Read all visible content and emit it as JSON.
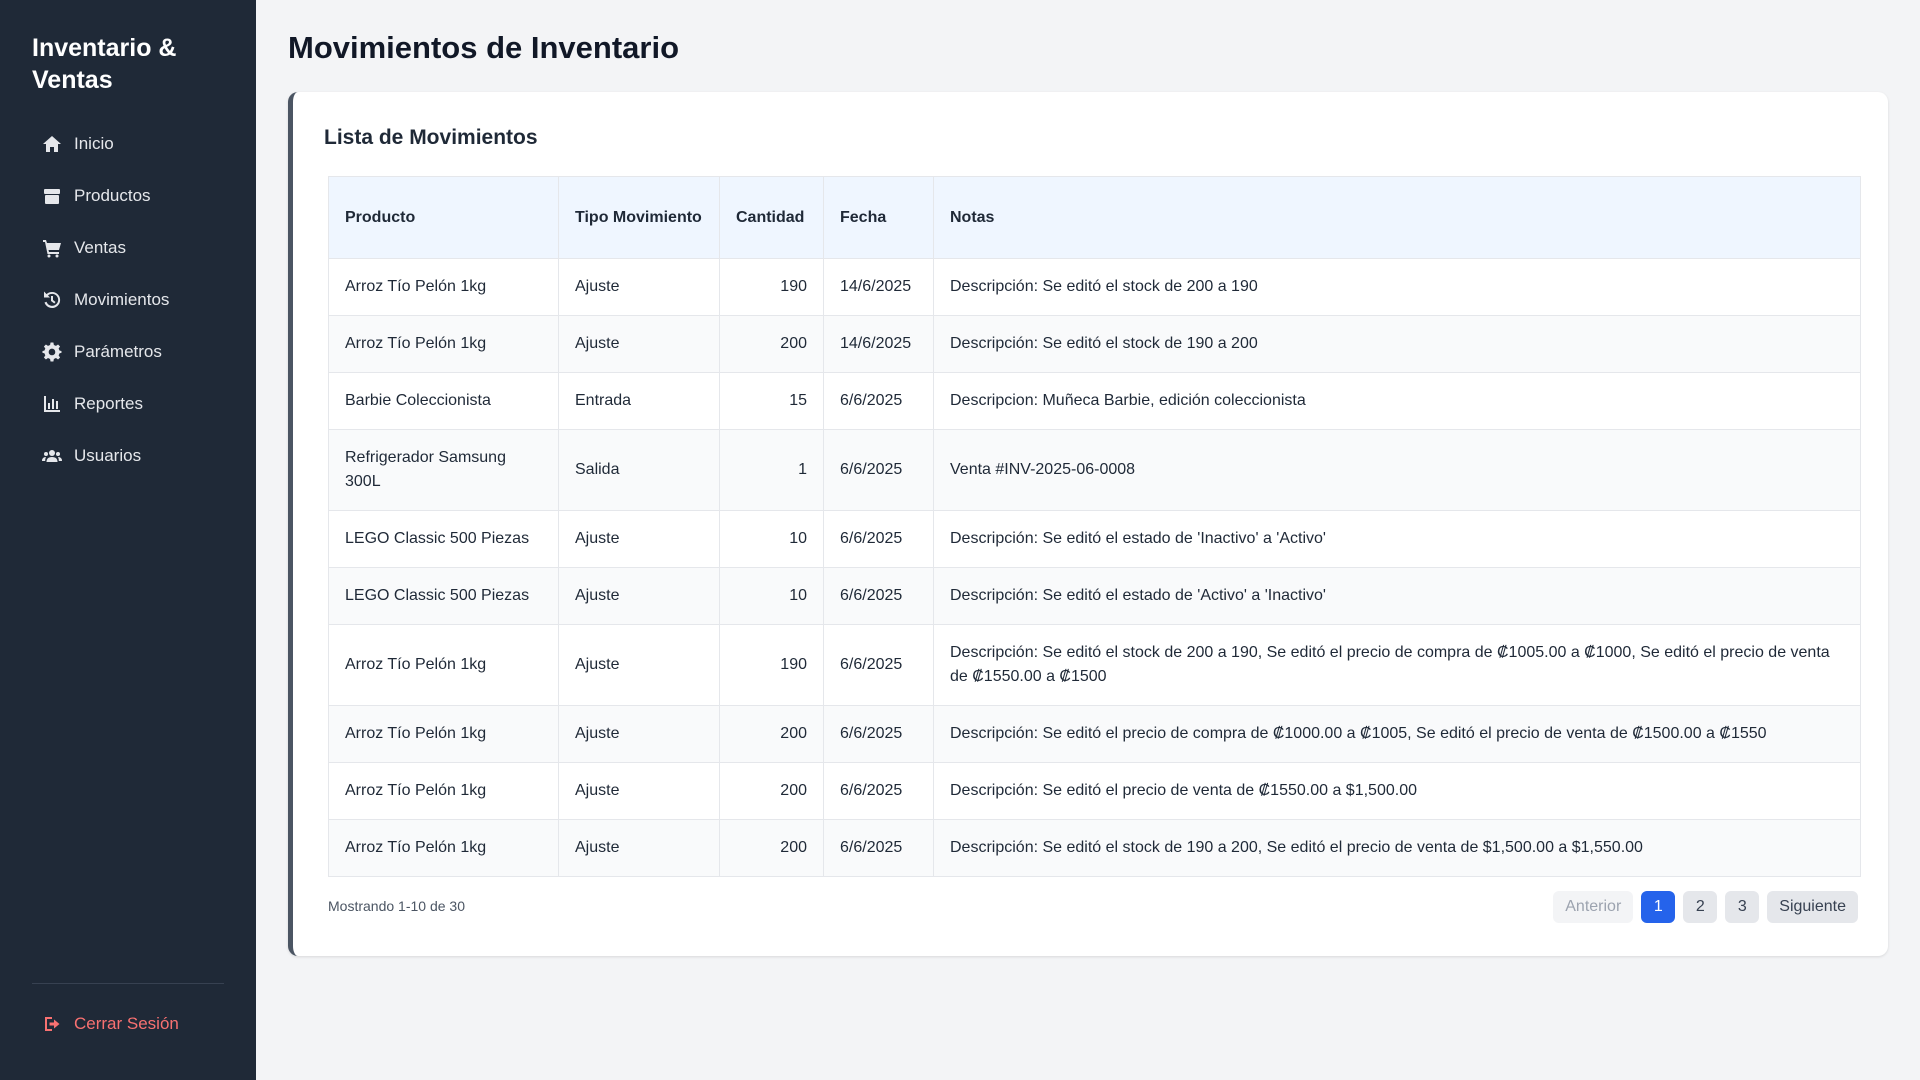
{
  "sidebar": {
    "brand": "Inventario & Ventas",
    "items": [
      {
        "label": "Inicio",
        "icon": "home-icon"
      },
      {
        "label": "Productos",
        "icon": "box-icon"
      },
      {
        "label": "Ventas",
        "icon": "cart-icon"
      },
      {
        "label": "Movimientos",
        "icon": "history-icon"
      },
      {
        "label": "Parámetros",
        "icon": "gear-icon"
      },
      {
        "label": "Reportes",
        "icon": "chart-icon"
      },
      {
        "label": "Usuarios",
        "icon": "users-icon"
      }
    ],
    "logout": "Cerrar Sesión"
  },
  "main": {
    "title": "Movimientos de Inventario",
    "card_title": "Lista de Movimientos",
    "table": {
      "headers": [
        "Producto",
        "Tipo Movimiento",
        "Cantidad",
        "Fecha",
        "Notas"
      ],
      "rows": [
        [
          "Arroz Tío Pelón 1kg",
          "Ajuste",
          "190",
          "14/6/2025",
          "Descripción: Se editó el stock de 200 a 190"
        ],
        [
          "Arroz Tío Pelón 1kg",
          "Ajuste",
          "200",
          "14/6/2025",
          "Descripción: Se editó el stock de 190 a 200"
        ],
        [
          "Barbie Coleccionista",
          "Entrada",
          "15",
          "6/6/2025",
          "Descripcion: Muñeca Barbie, edición coleccionista"
        ],
        [
          "Refrigerador Samsung 300L",
          "Salida",
          "1",
          "6/6/2025",
          "Venta #INV-2025-06-0008"
        ],
        [
          "LEGO Classic 500 Piezas",
          "Ajuste",
          "10",
          "6/6/2025",
          "Descripción: Se editó el estado de 'Inactivo' a 'Activo'"
        ],
        [
          "LEGO Classic 500 Piezas",
          "Ajuste",
          "10",
          "6/6/2025",
          "Descripción: Se editó el estado de 'Activo' a 'Inactivo'"
        ],
        [
          "Arroz Tío Pelón 1kg",
          "Ajuste",
          "190",
          "6/6/2025",
          "Descripción: Se editó el stock de 200 a 190, Se editó el precio de compra de ₡1005.00 a ₡1000, Se editó el precio de venta de ₡1550.00 a ₡1500"
        ],
        [
          "Arroz Tío Pelón 1kg",
          "Ajuste",
          "200",
          "6/6/2025",
          "Descripción: Se editó el precio de compra de ₡1000.00 a ₡1005, Se editó el precio de venta de ₡1500.00 a ₡1550"
        ],
        [
          "Arroz Tío Pelón 1kg",
          "Ajuste",
          "200",
          "6/6/2025",
          "Descripción: Se editó el precio de venta de ₡1550.00 a $1,500.00"
        ],
        [
          "Arroz Tío Pelón 1kg",
          "Ajuste",
          "200",
          "6/6/2025",
          "Descripción: Se editó el stock de 190 a 200, Se editó el precio de venta de $1,500.00 a $1,550.00"
        ]
      ]
    },
    "showing": "Mostrando 1-10 de 30",
    "pagination": {
      "prev": "Anterior",
      "pages": [
        "1",
        "2",
        "3"
      ],
      "current": "1",
      "next": "Siguiente"
    }
  },
  "colors": {
    "sidebar_bg": "#1f2937",
    "accent": "#2563eb",
    "logout": "#f87171",
    "header_bg": "#eff6ff"
  }
}
